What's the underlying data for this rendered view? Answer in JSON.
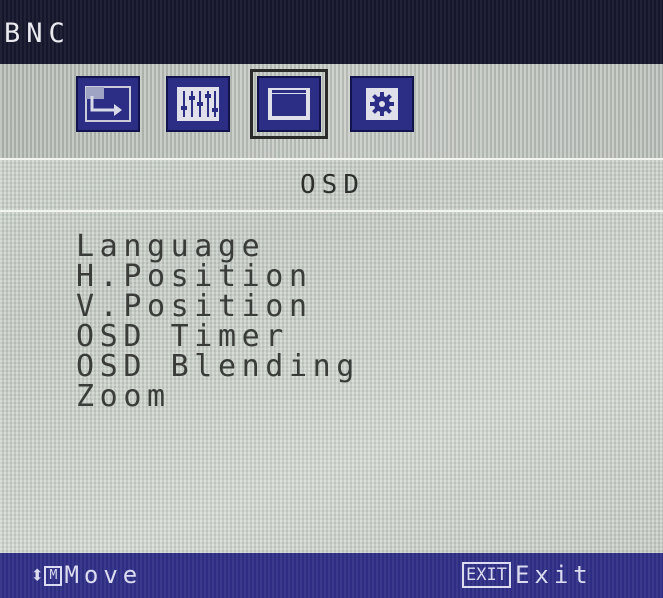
{
  "window": {
    "title": "BNC"
  },
  "tabs": [
    {
      "name": "input-source",
      "icon": "input-source-icon",
      "selected": false
    },
    {
      "name": "color-adjust",
      "icon": "sliders-icon",
      "selected": false
    },
    {
      "name": "osd",
      "icon": "osd-window-icon",
      "selected": true
    },
    {
      "name": "setup",
      "icon": "gear-icon",
      "selected": false
    }
  ],
  "section": {
    "title": "OSD"
  },
  "menu": {
    "items": [
      "Language",
      "H.Position",
      "V.Position",
      "OSD Timer",
      "OSD Blending",
      "Zoom"
    ]
  },
  "footer": {
    "move_icon": "up-down-arrows-icon",
    "move_key": "M",
    "move_label": "Move",
    "exit_key": "EXIT",
    "exit_label": "Exit"
  },
  "colors": {
    "title_bar": "#15162b",
    "tab_bg": "#2c2e86",
    "footer_bg": "#2e2d84",
    "panel_bg": "#c9cfc9",
    "text": "#3a3c3a"
  }
}
